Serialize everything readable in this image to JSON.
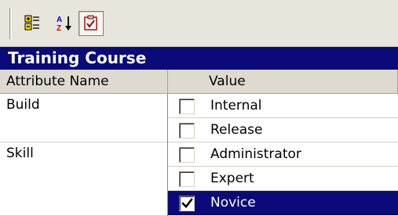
{
  "toolbar": {
    "buttons": [
      {
        "name": "categorized-button",
        "icon": "categorized-icon"
      },
      {
        "name": "alphabetical-button",
        "icon": "sort-az-icon"
      },
      {
        "name": "property-pages-button",
        "icon": "checked-page-icon"
      }
    ]
  },
  "panel": {
    "title": "Training Course"
  },
  "grid": {
    "headers": {
      "attribute": "Attribute Name",
      "value": "Value"
    },
    "attributes": [
      {
        "name": "Build",
        "values": [
          {
            "label": "Internal",
            "checked": false
          },
          {
            "label": "Release",
            "checked": false
          }
        ]
      },
      {
        "name": "Skill",
        "values": [
          {
            "label": "Administrator",
            "checked": false
          },
          {
            "label": "Expert",
            "checked": false
          },
          {
            "label": "Novice",
            "checked": true,
            "selected": true
          }
        ]
      }
    ]
  },
  "colors": {
    "selection": "#0a0a7a",
    "toolbar_bg": "#e8e5dc",
    "header_bg": "#dedad0"
  }
}
